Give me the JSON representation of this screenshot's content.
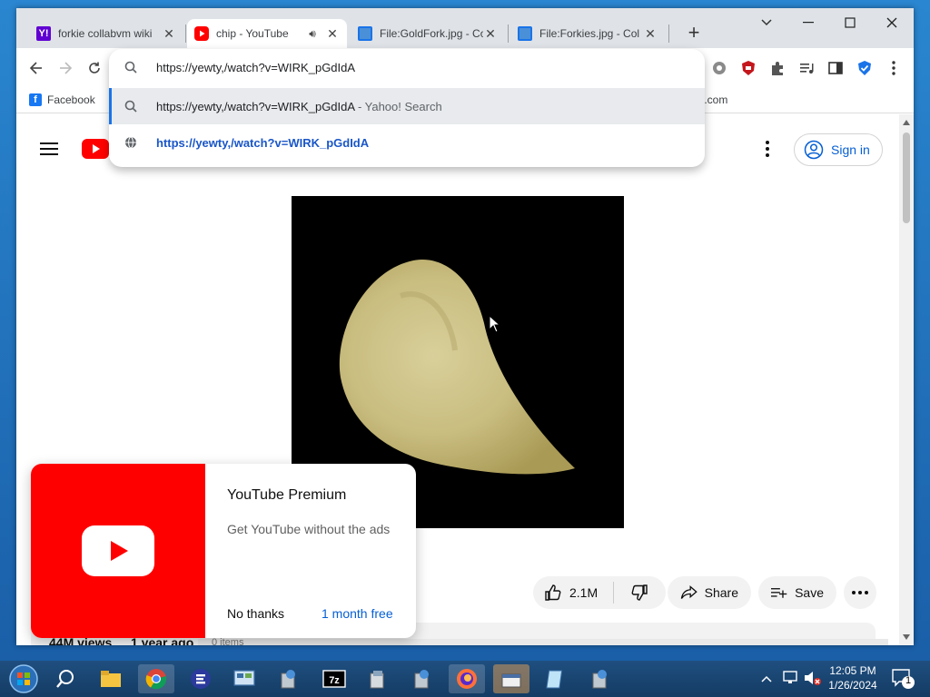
{
  "tabs": [
    {
      "title": "forkie collabvm wiki",
      "favicon": "yahoo-icon",
      "color": "#6001d2"
    },
    {
      "title": "chip - YouTube",
      "favicon": "youtube-icon",
      "color": "#ff0000",
      "audio": "speaker-icon",
      "active": true
    },
    {
      "title": "File:GoldFork.jpg - Co",
      "favicon": "monitor-icon",
      "color": "#1a73e8"
    },
    {
      "title": "File:Forkies.jpg - Col",
      "favicon": "monitor-icon",
      "color": "#1a73e8"
    }
  ],
  "new_tab_label": "+",
  "window_controls": {
    "dropdown": "⌄",
    "minimize": "—",
    "maximize": "☐",
    "close": "✕"
  },
  "omnibox": {
    "input": "https://yewty,/watch?v=WIRK_pGdIdA",
    "suggestions": [
      {
        "text": "https://yewty,/watch?v=WIRK_pGdIdA",
        "suffix": " - Yahoo! Search",
        "icon": "search-icon"
      },
      {
        "text": "https://yewty,/watch?v=WIRK_pGdIdA",
        "icon": "globe-icon"
      }
    ]
  },
  "bookmarks": [
    {
      "label": "Facebook",
      "icon": "facebook-icon"
    },
    {
      "label": "rt.com"
    }
  ],
  "youtube": {
    "sign_in": "Sign in",
    "likes": "2.1M",
    "share": "Share",
    "save": "Save",
    "views": "44M views",
    "age": "1 year ago",
    "comments_hint": "0 items"
  },
  "promo": {
    "title": "YouTube Premium",
    "body": "Get YouTube without the ads",
    "decline": "No thanks",
    "accept": "1 month free"
  },
  "clock": {
    "time": "12:05 PM",
    "date": "1/26/2024"
  },
  "notifications": "1",
  "colors": {
    "youtube_red": "#ff0000",
    "link_blue": "#065fd4",
    "omnibox_link": "#1a56c8"
  }
}
